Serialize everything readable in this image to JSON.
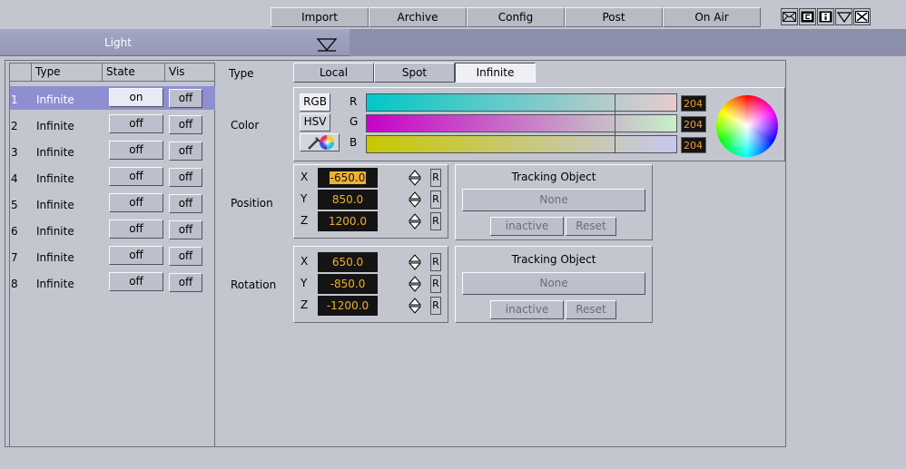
{
  "menu": [
    "Import",
    "Archive",
    "Config",
    "Post",
    "On Air"
  ],
  "header": {
    "title": "Light"
  },
  "table": {
    "columns": [
      "Type",
      "State",
      "Vis"
    ],
    "rows": [
      {
        "num": "1",
        "type": "Infinite",
        "state": "on",
        "vis": "off"
      },
      {
        "num": "2",
        "type": "Infinite",
        "state": "off",
        "vis": "off"
      },
      {
        "num": "3",
        "type": "Infinite",
        "state": "off",
        "vis": "off"
      },
      {
        "num": "4",
        "type": "Infinite",
        "state": "off",
        "vis": "off"
      },
      {
        "num": "5",
        "type": "Infinite",
        "state": "off",
        "vis": "off"
      },
      {
        "num": "6",
        "type": "Infinite",
        "state": "off",
        "vis": "off"
      },
      {
        "num": "7",
        "type": "Infinite",
        "state": "off",
        "vis": "off"
      },
      {
        "num": "8",
        "type": "Infinite",
        "state": "off",
        "vis": "off"
      }
    ]
  },
  "labels": {
    "type": "Type",
    "color": "Color",
    "position": "Position",
    "rotation": "Rotation"
  },
  "type_options": [
    "Local",
    "Spot",
    "Infinite"
  ],
  "type_selected": "Infinite",
  "color": {
    "modes": [
      "RGB",
      "HSV"
    ],
    "channels": [
      {
        "name": "R",
        "value": "204"
      },
      {
        "name": "G",
        "value": "204"
      },
      {
        "name": "B",
        "value": "204"
      }
    ]
  },
  "position": [
    {
      "axis": "X",
      "value": "-650.0"
    },
    {
      "axis": "Y",
      "value": "850.0"
    },
    {
      "axis": "Z",
      "value": "1200.0"
    }
  ],
  "rotation": [
    {
      "axis": "X",
      "value": "650.0"
    },
    {
      "axis": "Y",
      "value": "-850.0"
    },
    {
      "axis": "Z",
      "value": "-1200.0"
    }
  ],
  "reset_label": "R",
  "tracking": {
    "title": "Tracking Object",
    "none": "None",
    "inactive": "inactive",
    "reset": "Reset"
  },
  "colors": {
    "selected_row": "#8e8fd0",
    "field_text": "#f0b030",
    "panel": "#c4c6cf",
    "header": "#8c8faa"
  }
}
